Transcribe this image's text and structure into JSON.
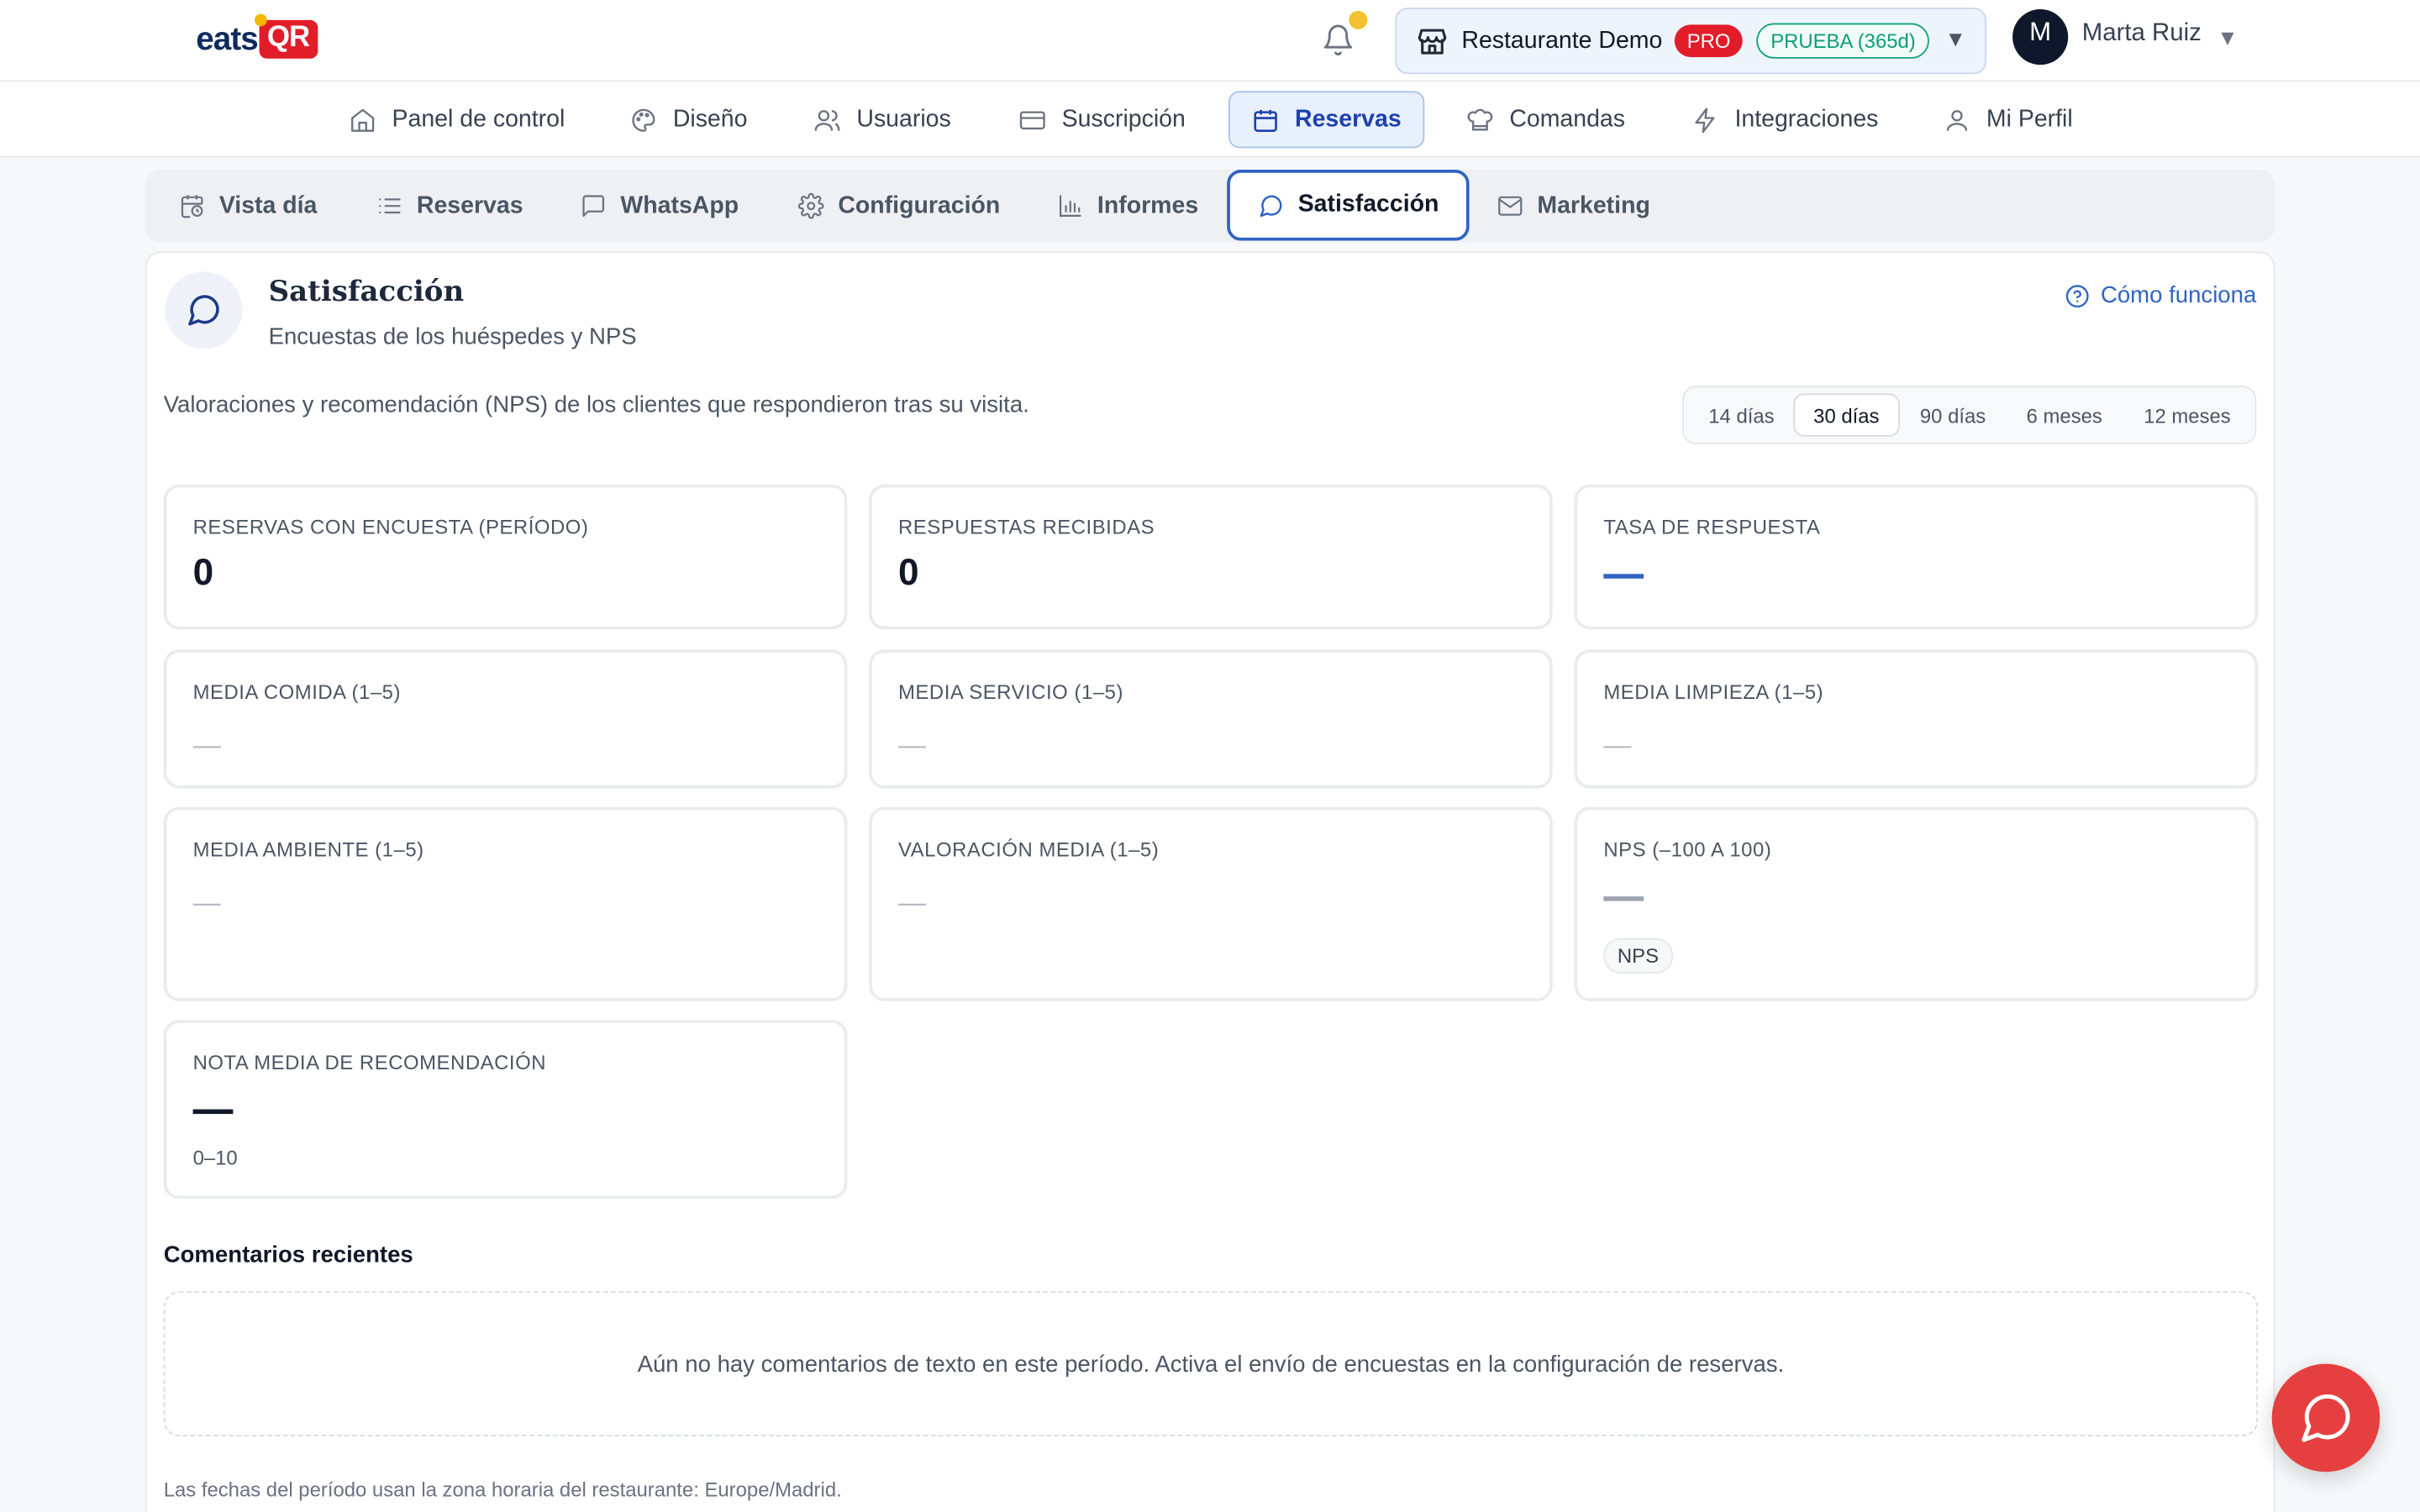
{
  "header": {
    "logo_text_1": "eats",
    "logo_text_2": "QR",
    "restaurant_name": "Restaurante Demo",
    "plan_badge": "PRO",
    "trial_badge": "PRUEBA (365d)",
    "caret": "▼",
    "user_initial": "M",
    "user_name": "Marta Ruiz"
  },
  "main_nav": [
    {
      "label": "Panel de control",
      "icon": "home-icon"
    },
    {
      "label": "Diseño",
      "icon": "palette-icon"
    },
    {
      "label": "Usuarios",
      "icon": "users-icon"
    },
    {
      "label": "Suscripción",
      "icon": "credit-card-icon"
    },
    {
      "label": "Reservas",
      "icon": "calendar-icon",
      "active": true
    },
    {
      "label": "Comandas",
      "icon": "chef-hat-icon"
    },
    {
      "label": "Integraciones",
      "icon": "lightning-icon"
    },
    {
      "label": "Mi Perfil",
      "icon": "user-icon"
    }
  ],
  "sub_nav": [
    {
      "label": "Vista día",
      "icon": "calendar-clock-icon"
    },
    {
      "label": "Reservas",
      "icon": "list-icon"
    },
    {
      "label": "WhatsApp",
      "icon": "message-square-icon"
    },
    {
      "label": "Configuración",
      "icon": "gear-icon"
    },
    {
      "label": "Informes",
      "icon": "bar-chart-icon"
    },
    {
      "label": "Satisfacción",
      "icon": "message-circle-icon",
      "active": true
    },
    {
      "label": "Marketing",
      "icon": "mail-icon"
    }
  ],
  "panel": {
    "title": "Satisfacción",
    "subtitle": "Encuestas de los huéspedes y NPS",
    "how_link": "Cómo funciona",
    "description": "Valoraciones y recomendación (NPS) de los clientes que respondieron tras su visita.",
    "ranges": [
      {
        "label": "14 días"
      },
      {
        "label": "30 días",
        "active": true
      },
      {
        "label": "90 días"
      },
      {
        "label": "6 meses"
      },
      {
        "label": "12 meses"
      }
    ]
  },
  "cards": {
    "reservations": {
      "label": "RESERVAS CON ENCUESTA (PERÍODO)",
      "value": "0"
    },
    "responses": {
      "label": "RESPUESTAS RECIBIDAS",
      "value": "0"
    },
    "response_rate": {
      "label": "TASA DE RESPUESTA",
      "color": "#2f64c2"
    },
    "food": {
      "label": "MEDIA COMIDA (1–5)",
      "value": "—"
    },
    "service": {
      "label": "MEDIA SERVICIO (1–5)",
      "value": "—"
    },
    "cleanliness": {
      "label": "MEDIA LIMPIEZA (1–5)",
      "value": "—"
    },
    "ambience": {
      "label": "MEDIA AMBIENTE (1–5)",
      "value": "—"
    },
    "rating": {
      "label": "VALORACIÓN MEDIA (1–5)",
      "value": "—"
    },
    "nps": {
      "label": "NPS (–100 A 100)",
      "chip": "NPS",
      "color": "#9ca3af"
    },
    "recommend": {
      "label": "NOTA MEDIA DE RECOMENDACIÓN",
      "scale": "0–10",
      "color": "#111827"
    }
  },
  "comments": {
    "title": "Comentarios recientes",
    "empty": "Aún no hay comentarios de texto en este período. Activa el envío de encuestas en la configuración de reservas."
  },
  "footnote": "Las fechas del período usan la zona horaria del restaurante: Europe/Madrid.",
  "colors": {
    "accent": "#2f64c2",
    "brand_red": "#e11d2a",
    "trial_green": "#0e9f77",
    "fab": "#e5403f"
  }
}
